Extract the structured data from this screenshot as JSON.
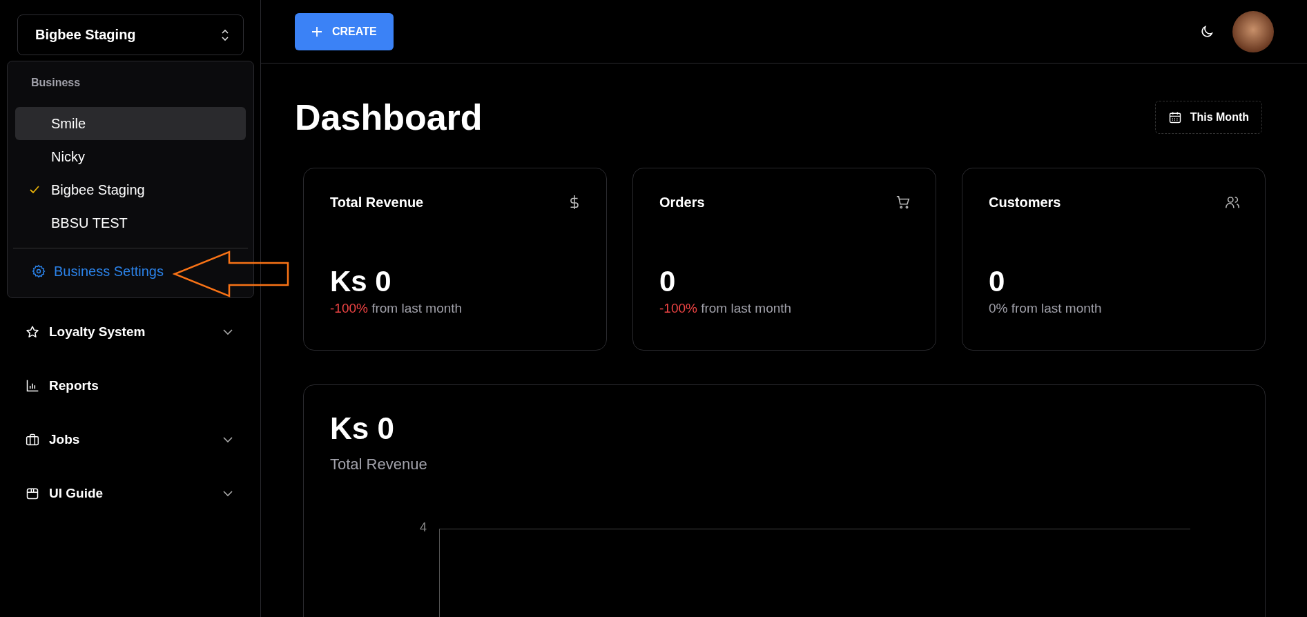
{
  "business_switcher": {
    "value": "Bigbee Staging"
  },
  "business_menu": {
    "heading": "Business",
    "items": [
      {
        "label": "Smile",
        "checked": false,
        "highlighted": true
      },
      {
        "label": "Nicky",
        "checked": false,
        "highlighted": false
      },
      {
        "label": "Bigbee Staging",
        "checked": true,
        "highlighted": false
      },
      {
        "label": "BBSU TEST",
        "checked": false,
        "highlighted": false
      }
    ],
    "settings_link": "Business Settings"
  },
  "nav": [
    {
      "label": "Loyalty System",
      "kind": "star",
      "expandable": true
    },
    {
      "label": "Reports",
      "kind": "chart",
      "expandable": false
    },
    {
      "label": "Jobs",
      "kind": "briefcase",
      "expandable": true
    },
    {
      "label": "UI Guide",
      "kind": "box",
      "expandable": true
    }
  ],
  "topbar": {
    "create_button": "CREATE"
  },
  "page": {
    "title": "Dashboard",
    "range_button": "This Month"
  },
  "stats": [
    {
      "title": "Total Revenue",
      "kind": "dollar",
      "value": "Ks 0",
      "change": "-100%",
      "change_negative": true,
      "suffix": "from last month"
    },
    {
      "title": "Orders",
      "kind": "cart",
      "value": "0",
      "change": "-100%",
      "change_negative": true,
      "suffix": "from last month"
    },
    {
      "title": "Customers",
      "kind": "users",
      "value": "0",
      "change": "0%",
      "change_negative": false,
      "suffix": "from last month"
    }
  ],
  "revenue_panel": {
    "value": "Ks 0",
    "label": "Total Revenue",
    "y_tick": "4"
  }
}
